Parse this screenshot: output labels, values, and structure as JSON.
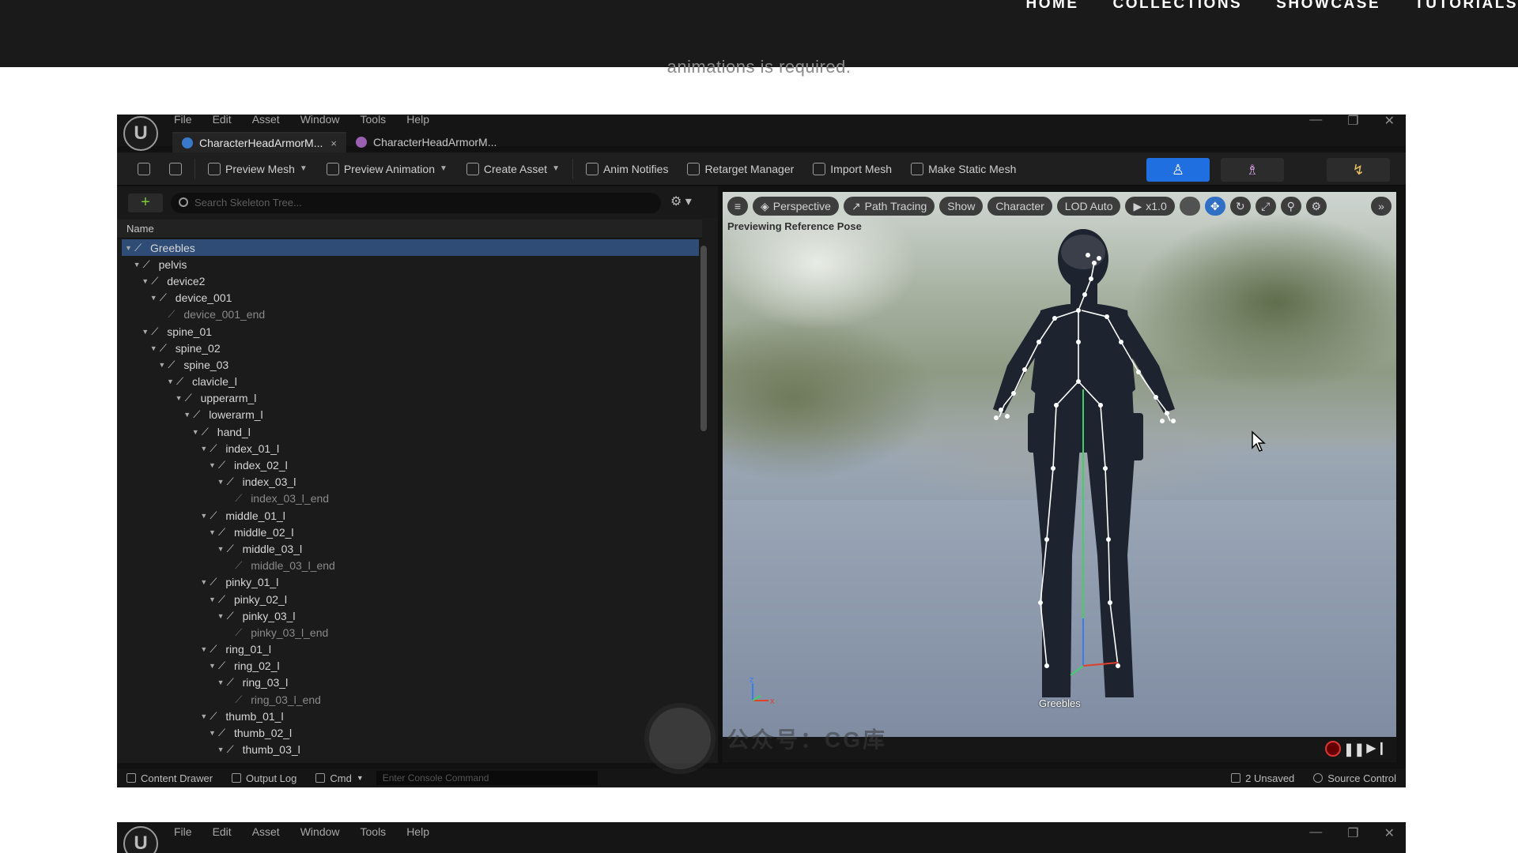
{
  "site": {
    "nav": [
      "HOME",
      "COLLECTIONS",
      "SHOWCASE",
      "TUTORIALS"
    ],
    "caption": "animations is required."
  },
  "editor": {
    "logo": "U",
    "menu": [
      "File",
      "Edit",
      "Asset",
      "Window",
      "Tools",
      "Help"
    ],
    "window_controls": [
      "—",
      "❐",
      "✕"
    ],
    "tabs": [
      {
        "label": "CharacterHeadArmorM...",
        "close": "×",
        "active": true
      },
      {
        "label": "CharacterHeadArmorM...",
        "active": false
      }
    ],
    "toolbar": {
      "preview_mesh": "Preview Mesh",
      "preview_animation": "Preview Animation",
      "create_asset": "Create Asset",
      "anim_notifies": "Anim Notifies",
      "retarget_manager": "Retarget Manager",
      "import_mesh": "Import Mesh",
      "make_static_mesh": "Make Static Mesh"
    },
    "skeleton": {
      "search_placeholder": "Search Skeleton Tree...",
      "add": "+",
      "column_name": "Name",
      "bones": [
        {
          "name": "Greebles",
          "depth": 0,
          "selected": true
        },
        {
          "name": "pelvis",
          "depth": 1
        },
        {
          "name": "device2",
          "depth": 2
        },
        {
          "name": "device_001",
          "depth": 3
        },
        {
          "name": "device_001_end",
          "depth": 4,
          "dim": true
        },
        {
          "name": "spine_01",
          "depth": 2
        },
        {
          "name": "spine_02",
          "depth": 3
        },
        {
          "name": "spine_03",
          "depth": 4
        },
        {
          "name": "clavicle_l",
          "depth": 5
        },
        {
          "name": "upperarm_l",
          "depth": 6
        },
        {
          "name": "lowerarm_l",
          "depth": 7
        },
        {
          "name": "hand_l",
          "depth": 8
        },
        {
          "name": "index_01_l",
          "depth": 9
        },
        {
          "name": "index_02_l",
          "depth": 10
        },
        {
          "name": "index_03_l",
          "depth": 11
        },
        {
          "name": "index_03_l_end",
          "depth": 12,
          "dim": true
        },
        {
          "name": "middle_01_l",
          "depth": 9
        },
        {
          "name": "middle_02_l",
          "depth": 10
        },
        {
          "name": "middle_03_l",
          "depth": 11
        },
        {
          "name": "middle_03_l_end",
          "depth": 12,
          "dim": true
        },
        {
          "name": "pinky_01_l",
          "depth": 9
        },
        {
          "name": "pinky_02_l",
          "depth": 10
        },
        {
          "name": "pinky_03_l",
          "depth": 11
        },
        {
          "name": "pinky_03_l_end",
          "depth": 12,
          "dim": true
        },
        {
          "name": "ring_01_l",
          "depth": 9
        },
        {
          "name": "ring_02_l",
          "depth": 10
        },
        {
          "name": "ring_03_l",
          "depth": 11
        },
        {
          "name": "ring_03_l_end",
          "depth": 12,
          "dim": true
        },
        {
          "name": "thumb_01_l",
          "depth": 9
        },
        {
          "name": "thumb_02_l",
          "depth": 10
        },
        {
          "name": "thumb_03_l",
          "depth": 11
        }
      ]
    },
    "viewport": {
      "perspective": "Perspective",
      "path_tracing": "Path Tracing",
      "show": "Show",
      "character": "Character",
      "lod": "LOD Auto",
      "speed": "x1.0",
      "status": "Previewing Reference Pose",
      "root_label": "Greebles",
      "axis_z": "z",
      "axis_x": "x"
    },
    "statusbar": {
      "content_drawer": "Content Drawer",
      "output_log": "Output Log",
      "cmd": "Cmd",
      "console_placeholder": "Enter Console Command",
      "unsaved": "2 Unsaved",
      "source_control": "Source Control"
    }
  },
  "watermark": "公众号：CG库",
  "colors": {
    "accent": "#2f6fc4",
    "selection": "#2e4c75",
    "site_header": "#1a1a1a"
  }
}
